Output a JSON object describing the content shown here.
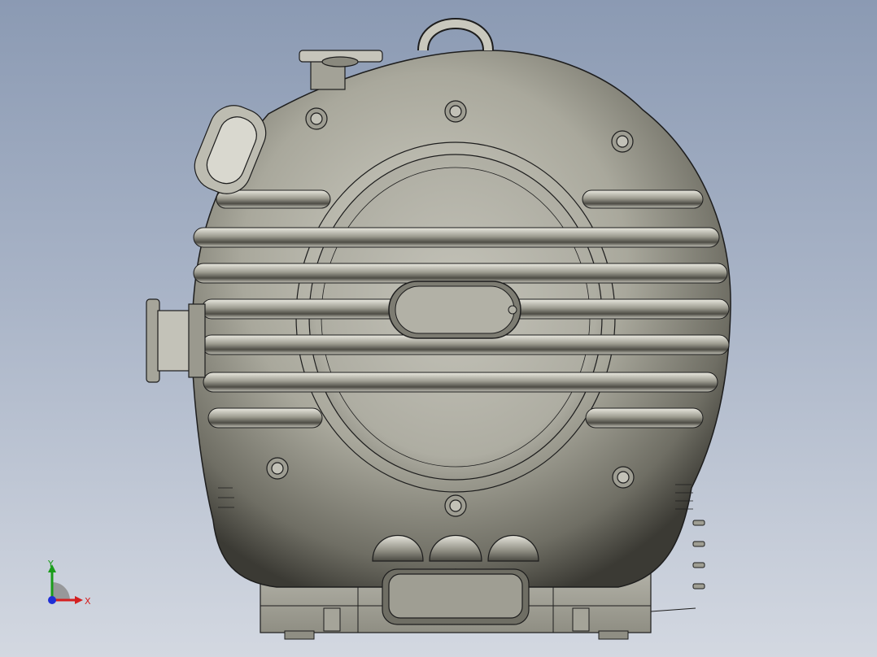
{
  "viewport": {
    "background_top": "#8b9ab3",
    "background_bottom": "#d3d8e1"
  },
  "model": {
    "body_color": "#b9b8ad",
    "edge_color": "#1d1d1d"
  },
  "triad": {
    "x_label": "X",
    "y_label": "Y",
    "x_color": "#d42020",
    "y_color": "#1a9c1a",
    "z_color": "#1f2fd6"
  }
}
